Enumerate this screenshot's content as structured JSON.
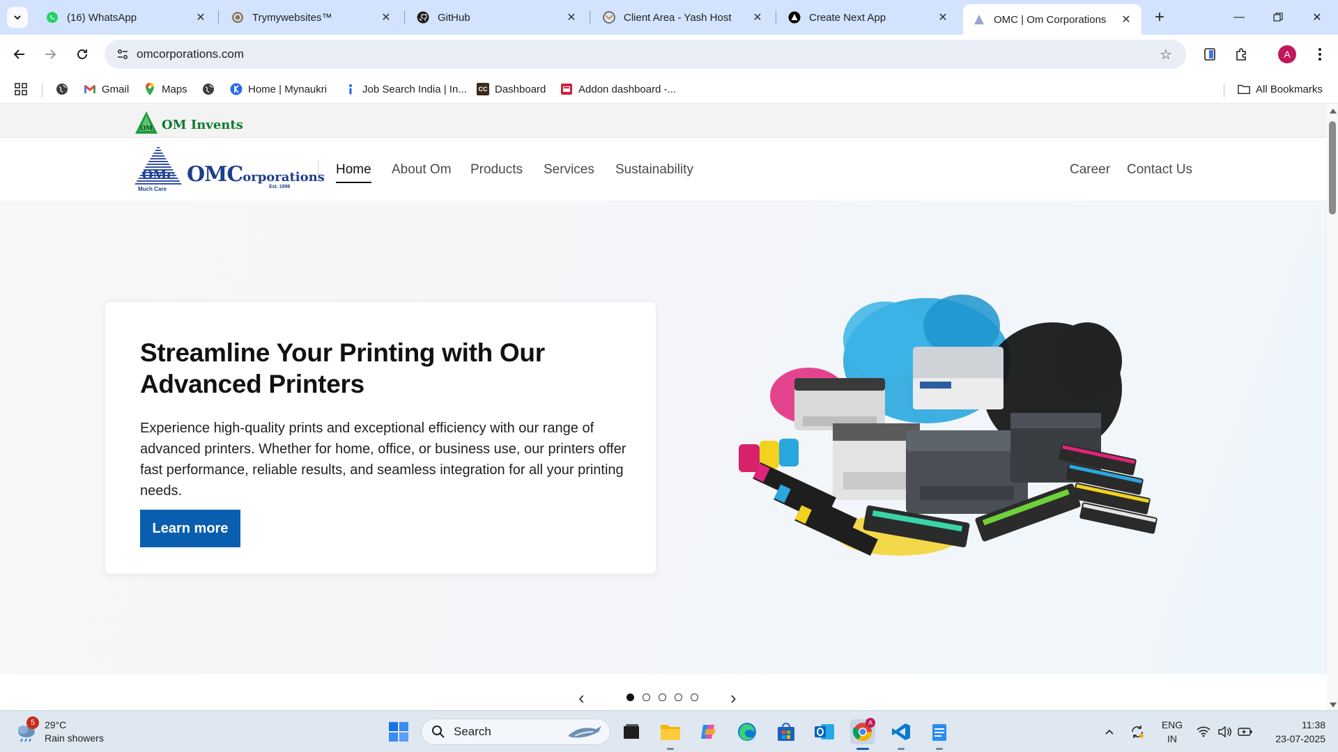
{
  "browser": {
    "tabs": [
      {
        "title": "(16) WhatsApp",
        "icon": "whatsapp-icon"
      },
      {
        "title": "Trymywebsites™",
        "icon": "trymywebsites-icon"
      },
      {
        "title": "GitHub",
        "icon": "github-icon"
      },
      {
        "title": "Client Area - Yash Host",
        "icon": "yashhost-icon"
      },
      {
        "title": "Create Next App",
        "icon": "nextjs-icon"
      },
      {
        "title": "OMC | Om Corporations",
        "icon": "omc-favicon",
        "active": true
      }
    ],
    "url": "omcorporations.com",
    "profile_initial": "A",
    "bookmarks": [
      {
        "label": "Gmail",
        "icon": "gmail-icon"
      },
      {
        "label": "Maps",
        "icon": "maps-icon"
      },
      {
        "label": "Home | Mynaukri",
        "icon": "mynaukri-icon"
      },
      {
        "label": "Job Search India | In...",
        "icon": "indeed-icon"
      },
      {
        "label": "Dashboard",
        "icon": "cc-icon",
        "icon_text": "CC"
      },
      {
        "label": "Addon dashboard -...",
        "icon": "addon-icon"
      }
    ],
    "all_bookmarks_label": "All Bookmarks"
  },
  "site": {
    "top_brand": "OM Invents",
    "logo": {
      "main": "OMC",
      "suffix": "orporations",
      "est": "Est. 1996",
      "tagline": "Much Care",
      "mark": "OMc"
    },
    "nav": [
      {
        "label": "Home",
        "active": true
      },
      {
        "label": "About Om"
      },
      {
        "label": "Products"
      },
      {
        "label": "Services"
      },
      {
        "label": "Sustainability"
      }
    ],
    "nav_right": [
      {
        "label": "Career"
      },
      {
        "label": "Contact Us"
      }
    ],
    "hero": {
      "title": "Streamline Your Printing with Our Advanced Printers",
      "description": "Experience high-quality prints and exceptional efficiency with our range of advanced printers. Whether for home, office, or business use, our printers offer fast performance, reliable results, and seamless integration for all your printing needs.",
      "button": "Learn more"
    },
    "carousel": {
      "slides": 5,
      "active_index": 0
    }
  },
  "taskbar": {
    "weather": {
      "temp": "29°C",
      "condition": "Rain showers",
      "badge": "5"
    },
    "search_label": "Search",
    "apps": [
      "start-icon",
      "task-view-icon",
      "file-explorer-icon",
      "copilot-icon",
      "edge-icon",
      "store-icon",
      "outlook-icon",
      "chrome-icon",
      "vscode-icon",
      "notepad-icon"
    ],
    "language": {
      "line1": "ENG",
      "line2": "IN"
    },
    "time": "11:38",
    "date": "23-07-2025"
  },
  "colors": {
    "tabstrip": "#d3e3fd",
    "primary_button": "#0a5eb0",
    "brand_blue": "#1e3e8f",
    "brand_green": "#0f7a2c"
  }
}
